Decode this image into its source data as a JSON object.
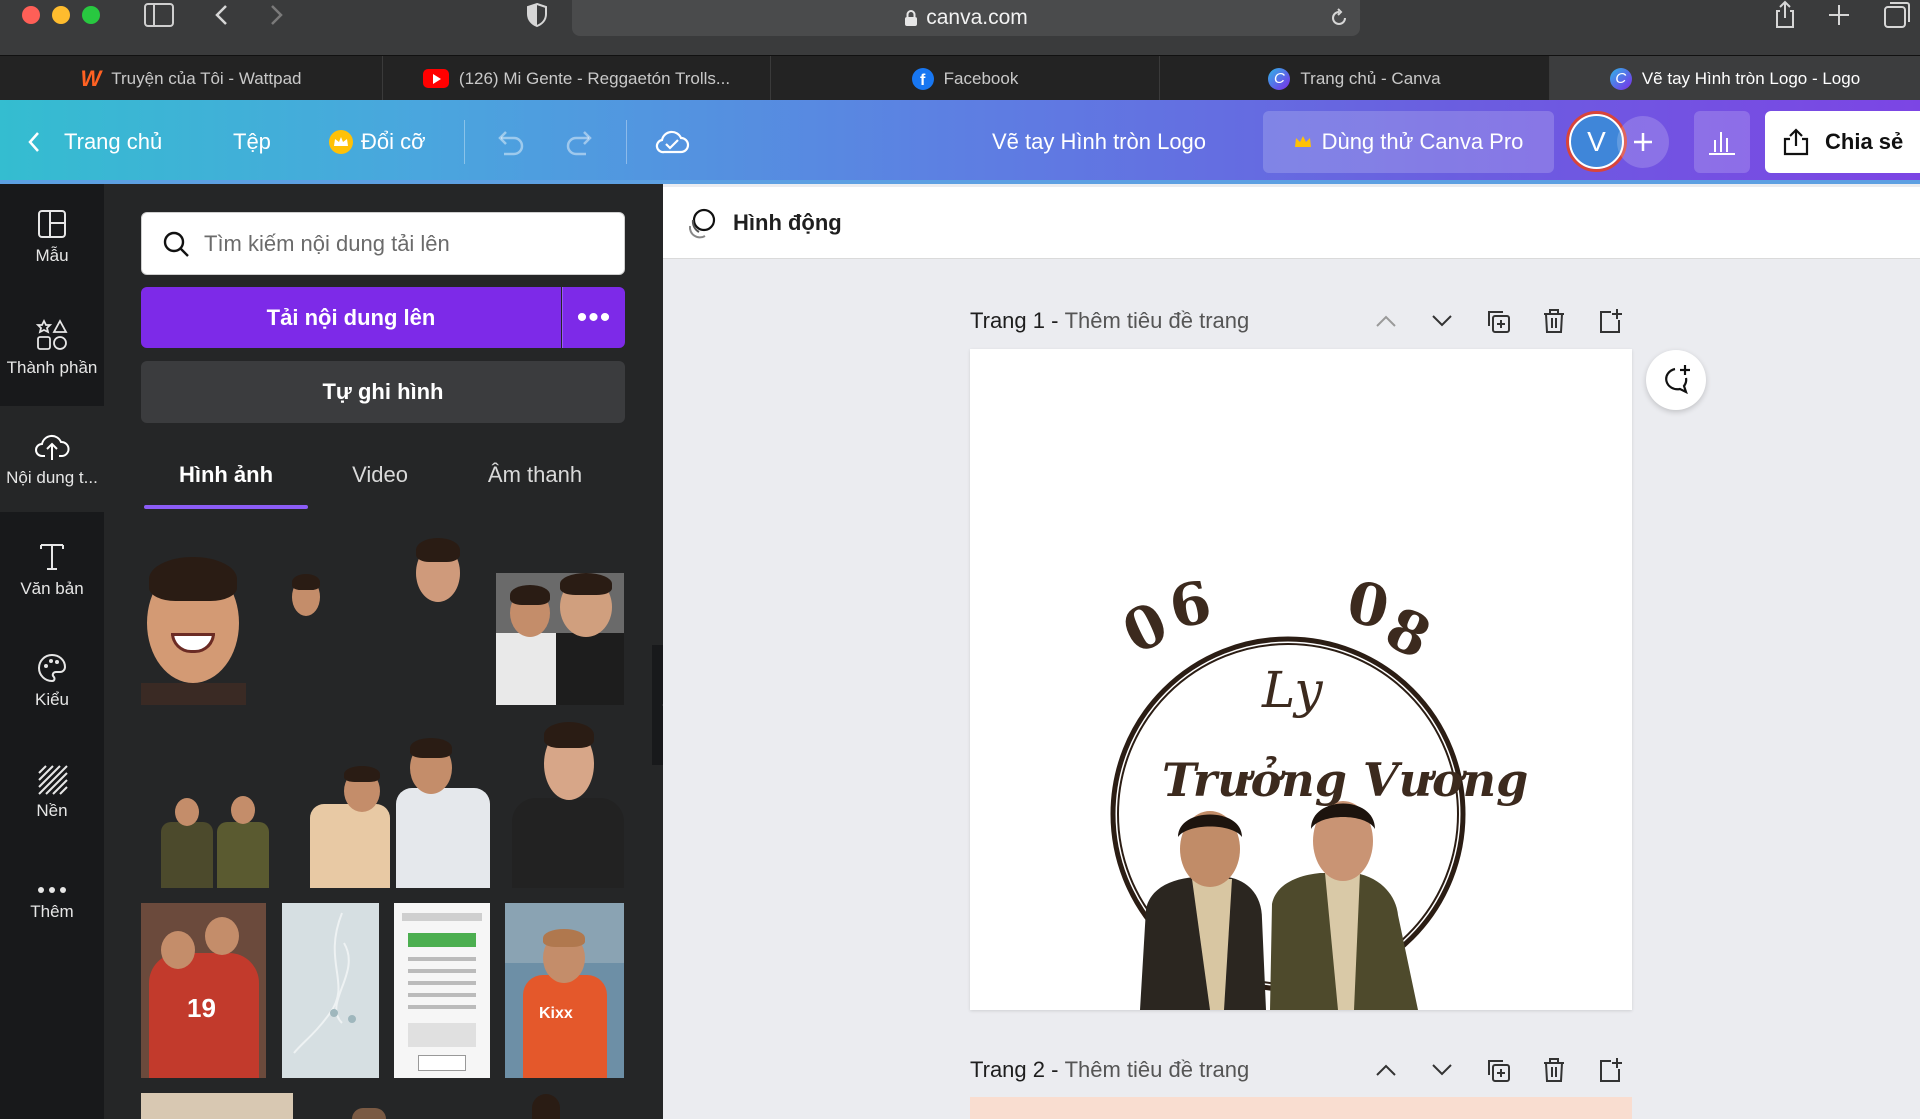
{
  "browser": {
    "url": "canva.com",
    "tabs": [
      {
        "label": "Truyện của Tôi - Wattpad",
        "icon": "wattpad-icon",
        "icon_color": "#ff6122"
      },
      {
        "label": "(126) Mi Gente - Reggaetón Trolls...",
        "icon": "youtube-icon",
        "icon_color": "#ff0000"
      },
      {
        "label": "Facebook",
        "icon": "facebook-icon",
        "icon_color": "#1877f2"
      },
      {
        "label": "Trang chủ - Canva",
        "icon": "canva-icon",
        "icon_color": "#2fb6e7"
      },
      {
        "label": "Vẽ tay Hình tròn Logo - Logo",
        "icon": "canva-icon",
        "icon_color": "#2fb6e7",
        "active": true
      }
    ]
  },
  "header": {
    "home_label": "Trang chủ",
    "file_label": "Tệp",
    "resize_label": "Đổi cỡ",
    "doc_title": "Vẽ tay Hình tròn Logo",
    "pro_label": "Dùng thử Canva Pro",
    "avatar_letter": "V",
    "share_label": "Chia sẻ"
  },
  "rail": [
    {
      "label": "Mẫu",
      "icon": "template-icon"
    },
    {
      "label": "Thành phần",
      "icon": "elements-icon"
    },
    {
      "label": "Nội dung t...",
      "icon": "upload-cloud-icon",
      "active": true
    },
    {
      "label": "Văn bản",
      "icon": "text-icon"
    },
    {
      "label": "Kiểu",
      "icon": "palette-icon"
    },
    {
      "label": "Nền",
      "icon": "background-icon"
    },
    {
      "label": "Thêm",
      "icon": "more-icon"
    }
  ],
  "panel": {
    "search_placeholder": "Tìm kiếm nội dung tải lên",
    "upload_label": "Tải nội dung lên",
    "upload_more": "•••",
    "record_label": "Tự ghi hình",
    "tabs": [
      "Hình ảnh",
      "Video",
      "Âm thanh"
    ]
  },
  "editor": {
    "animate_label": "Hình động",
    "pages": [
      {
        "number_label": "Trang 1",
        "title_placeholder": "Thêm tiêu đề trang"
      },
      {
        "number_label": "Trang 2",
        "title_placeholder": "Thêm tiêu đề trang"
      }
    ],
    "logo": {
      "digits": [
        "0",
        "6",
        "0",
        "8"
      ],
      "signature": "Ly",
      "name": "Trưởng Vương"
    }
  },
  "colors": {
    "canva_purple": "#7d2ae8",
    "rail_bg": "#18191b",
    "panel_bg": "#252627",
    "logo_brown": "#3c2a1e"
  }
}
